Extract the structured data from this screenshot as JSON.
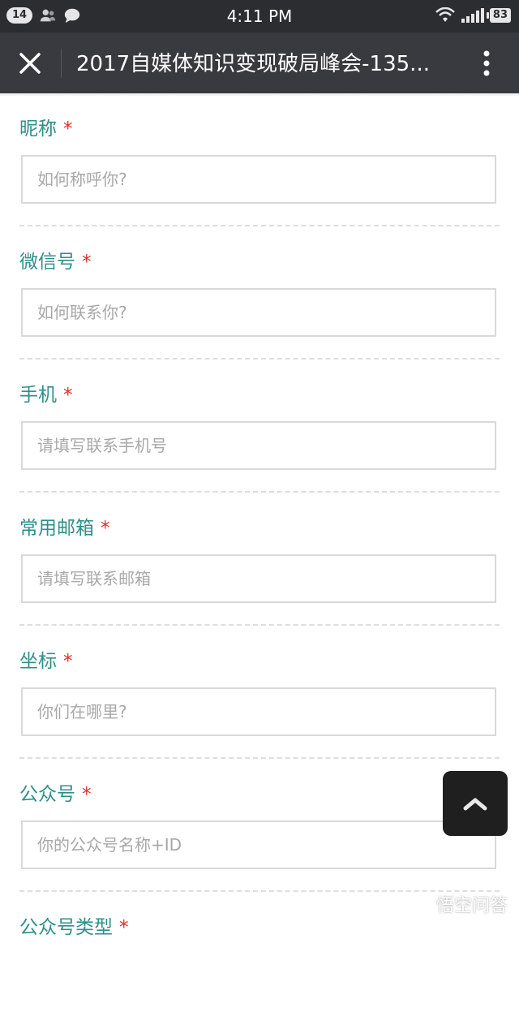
{
  "status_bar": {
    "notification_count": "14",
    "time": "4:11 PM",
    "battery": "83"
  },
  "title_bar": {
    "title": "2017自媒体知识变现破局峰会-135..."
  },
  "form": {
    "fields": [
      {
        "label": "昵称",
        "required_mark": "*",
        "placeholder": "如何称呼你?"
      },
      {
        "label": "微信号",
        "required_mark": "*",
        "placeholder": "如何联系你?"
      },
      {
        "label": "手机",
        "required_mark": "*",
        "placeholder": "请填写联系手机号"
      },
      {
        "label": "常用邮箱",
        "required_mark": "*",
        "placeholder": "请填写联系邮箱"
      },
      {
        "label": "坐标",
        "required_mark": "*",
        "placeholder": "你们在哪里?"
      },
      {
        "label": "公众号",
        "required_mark": "*",
        "placeholder": "你的公众号名称+ID"
      },
      {
        "label": "公众号类型",
        "required_mark": "*",
        "placeholder": ""
      }
    ]
  },
  "watermark": {
    "text": "悟空问答"
  },
  "icons": {
    "close": "close-icon",
    "more": "more-vertical-icon",
    "scroll_top": "chevron-up-icon"
  },
  "colors": {
    "status_bar_bg": "#2b2d30",
    "title_bar_bg": "#393a3f",
    "label_color": "#2f8f8a",
    "required_color": "#e02b2b"
  }
}
